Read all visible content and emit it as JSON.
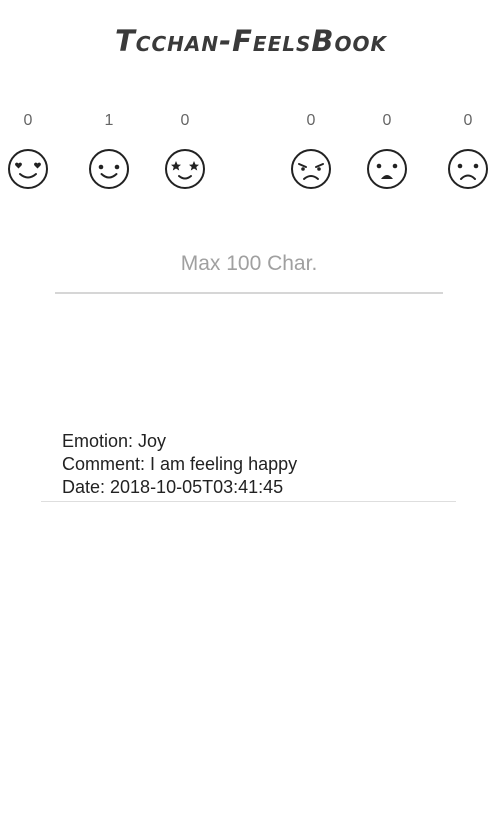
{
  "app": {
    "title": "Tcchan-FeelsBook"
  },
  "emotions": [
    {
      "name": "love",
      "count": "0",
      "icon": "heart-eyes-face-icon"
    },
    {
      "name": "joy",
      "count": "1",
      "icon": "smiling-face-icon"
    },
    {
      "name": "surprise",
      "count": "0",
      "icon": "star-eyes-face-icon"
    },
    {
      "name": "anger",
      "count": "0",
      "icon": "angry-face-icon"
    },
    {
      "name": "fear",
      "count": "0",
      "icon": "fearful-face-icon"
    },
    {
      "name": "sadness",
      "count": "0",
      "icon": "sad-face-icon"
    }
  ],
  "comment": {
    "placeholder": "Max 100 Char.",
    "value": ""
  },
  "history": [
    {
      "emotion": "Emotion: Joy",
      "comment": "Comment: I am feeling happy",
      "date": "Date: 2018-10-05T03:41:45"
    }
  ],
  "colors": {
    "icon_stroke": "#222222",
    "divider": "#d6d6d6"
  }
}
